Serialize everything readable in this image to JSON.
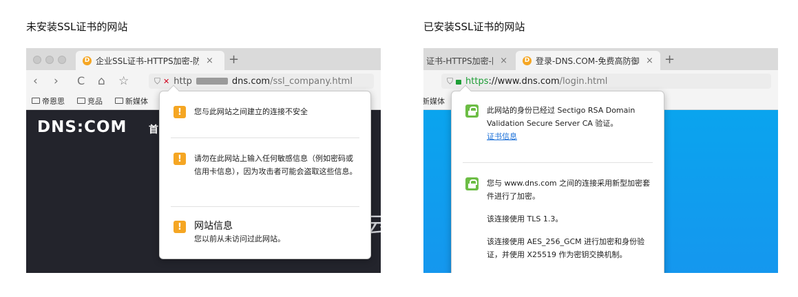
{
  "left": {
    "caption": "未安装SSL证书的网站",
    "tab": {
      "favicon": "D",
      "title": "企业SSL证书-HTTPS加密-防",
      "close": "×"
    },
    "new_tab": "+",
    "nav": {
      "back": "‹",
      "forward": "›",
      "reload": "C",
      "home": "⌂",
      "star": "☆"
    },
    "url": {
      "prefix": "http",
      "domain": "dns.com",
      "path": "/ssl_company.html"
    },
    "bookmarks": [
      "帝恩思",
      "竞品",
      "新媒体"
    ],
    "site_logo": "DNS:COM",
    "site_nav_glimpse": "首",
    "site_glimpse_right": "云",
    "popup": {
      "items": [
        {
          "icon": "!",
          "text": "您与此网站之间建立的连接不安全"
        },
        {
          "icon": "!",
          "text": "请勿在此网站上输入任何敏感信息（例如密码或信用卡信息），因为攻击者可能会盗取这些信息。"
        },
        {
          "icon": "!",
          "title": "网站信息",
          "text": "您以前从未访问过此网站。"
        }
      ]
    }
  },
  "right": {
    "caption": "已安装SSL证书的网站",
    "tab_prev": {
      "title": "证书-HTTPS加密-防",
      "close": "×"
    },
    "tab": {
      "favicon": "D",
      "title": "登录-DNS.COM-免费高防御",
      "close": "×"
    },
    "new_tab": "+",
    "url": {
      "scheme": "https",
      "rest": "://www.dns.com",
      "path": "/login.html"
    },
    "bookmarks": [
      "新媒体"
    ],
    "popup": {
      "identity": "此网站的身份已经过 Sectigo RSA Domain Validation Secure Server CA 验证。",
      "cert_link": "证书信息",
      "encryption": "您与 www.dns.com 之间的连接采用新型加密套件进行了加密。",
      "tls": "该连接使用 TLS 1.3。",
      "cipher": "该连接使用 AES_256_GCM 进行加密和身份验证，并使用 X25519 作为密钥交换机制。"
    }
  },
  "colors": {
    "warning": "#f5a623",
    "secure": "#6cbd45",
    "link": "#1a6fd8",
    "site_dark": "#23242c",
    "site_blue": "#0aa4ee"
  }
}
